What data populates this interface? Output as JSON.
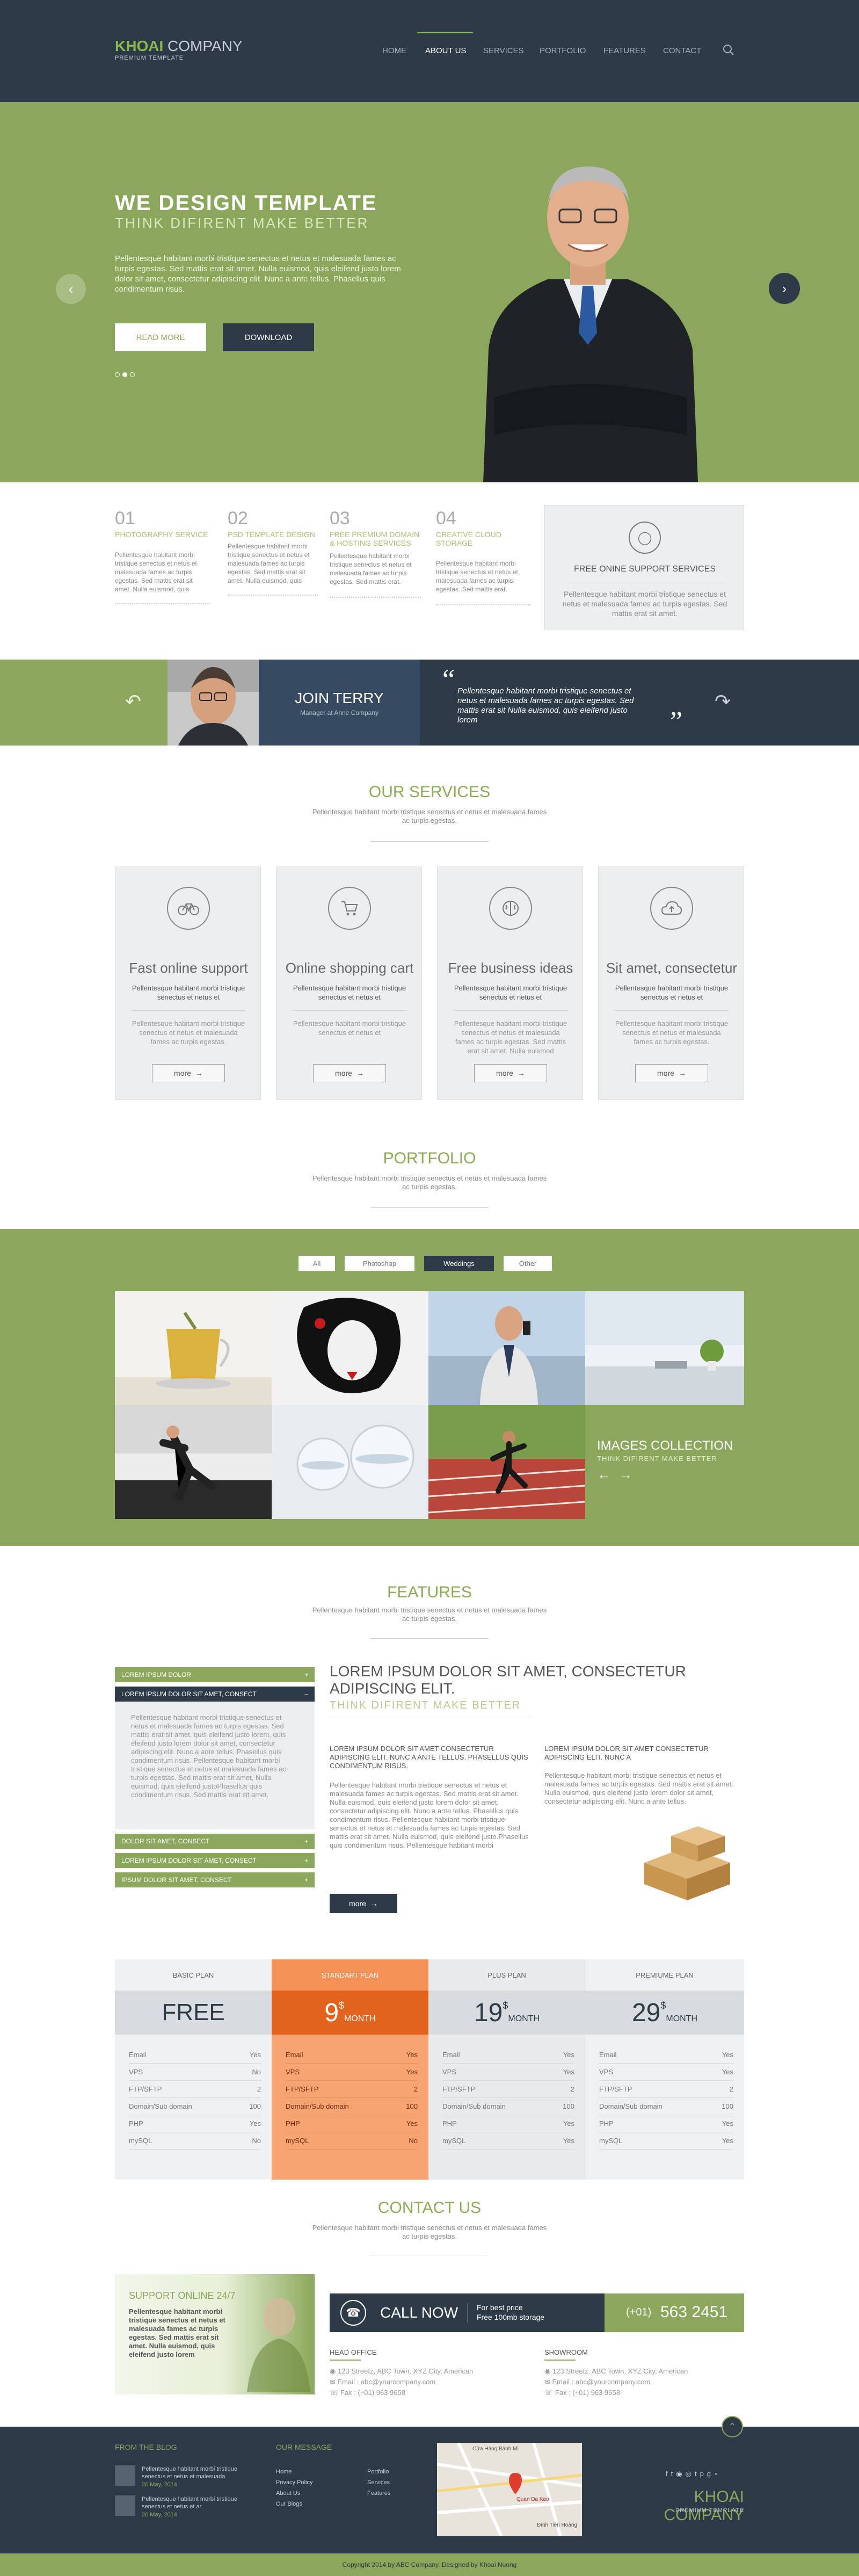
{
  "brand": {
    "name_bold": "KHOAI",
    "name_light": " COMPANY",
    "tagline": "PREMIUM TEMPLATE"
  },
  "nav": {
    "items": [
      "HOME",
      "ABOUT US",
      "SERVICES",
      "PORTFOLIO",
      "FEATURES",
      "CONTACT"
    ],
    "active": "ABOUT US"
  },
  "hero": {
    "title": "WE DESIGN TEMPLATE",
    "subtitle": "THINK DIFIRENT MAKE BETTER",
    "body": "Pellentesque habitant morbi tristique senectus et netus et malesuada fames ac turpis egestas. Sed mattis erat sit amet. Nulla euismod, quis eleifend justo lorem dolor sit amet, consectetur adipiscing elit. Nunc a ante tellus. Phasellus quis condimentum risus.",
    "read_more": "READ MORE",
    "download": "DOWNLOAD",
    "slides": 3
  },
  "features_row": [
    {
      "num": "01",
      "title": "PHOTOGRAPHY SERVICE",
      "text": "Pellentesque habitant morbi tristique senectus et netus et malesuada fames ac turpis egestas. Sed mattis erat sit amet. Nulla euismod, quis eleifend justo lorem."
    },
    {
      "num": "02",
      "title": "PSD TEMPLATE DESIGN",
      "text": "Pellentesque habitant morbi tristique senectus et netus et malesuada fames ac turpis egestas. Sed mattis erat sit amet. Nulla euismod, quis eleifend justo lorem."
    },
    {
      "num": "03",
      "title": "FREE PREMIUM DOMAIN & HOSTING SERVICES",
      "text": "Pellentesque habitant morbi tristique senectus et netus et malesuada fames ac turpis egestas. Sed mattis erat."
    },
    {
      "num": "04",
      "title": "CREATIVE CLOUD STORAGE",
      "text": "Pellentesque habitant morbi tristique senectus et netus et malesuada fames ac turpis egestas. Sed mattis erat."
    }
  ],
  "support_box": {
    "title": "FREE ONINE SUPPORT SERVICES",
    "text": "Pellentesque habitant morbi tristique senectus et netus et malesuada fames ac turpis egestas. Sed mattis erat sit amet."
  },
  "testimonial": {
    "name": "JOIN TERRY",
    "role": "Manager at Anne Company",
    "quote": "Pellentesque habitant morbi tristique senectus et netus et malesuada fames ac turpis egestas. Sed mattis erat sit Nulla euismod, quis eleifend justo lorem"
  },
  "services": {
    "heading": "OUR SERVICES",
    "sub": "Pellentesque habitant morbi tristique senectus et netus et malesuada fames ac turpis egestas.",
    "cards": [
      {
        "title": "Fast online support",
        "t1": "Pellentesque habitant morbi tristique senectus et netus et",
        "t2": "Pellentesque habitant morbi tristique senectus et netus et malesuada fames ac turpis egestas.",
        "more": "more"
      },
      {
        "title": "Online shopping cart",
        "t1": "Pellentesque habitant morbi tristique senectus et netus et",
        "t2": "Pellentesque habitant morbi tristique senectus et netus et",
        "more": "more"
      },
      {
        "title": "Free business ideas",
        "t1": "Pellentesque habitant morbi tristique senectus et netus et",
        "t2": "Pellentesque habitant morbi tristique senectus et netus et malesuada fames ac turpis egestas. Sed mattis erat sit amet. Nulla euismod",
        "more": "more"
      },
      {
        "title": "Sit amet, consectetur",
        "t1": "Pellentesque habitant morbi tristique senectus et netus et",
        "t2": "Pellentesque habitant morbi tristique senectus et netus et malesuada fames ac turpis egestas.",
        "more": "more"
      }
    ]
  },
  "portfolio": {
    "heading": "PORTFOLIO",
    "sub": "Pellentesque habitant morbi tristique senectus et netus et malesuada fames ac turpis egestas.",
    "filters": [
      "All",
      "Photoshop",
      "Weddings",
      "Other"
    ],
    "active_filter": "Weddings",
    "collection_title": "IMAGES COLLECTION",
    "collection_sub": "THINK DIFIRENT MAKE BETTER"
  },
  "features": {
    "heading": "FEATURES",
    "sub": "Pellentesque habitant morbi tristique senectus et netus et malesuada fames ac turpis egestas.",
    "accordion": [
      "LOREM IPSUM DOLOR",
      "LOREM IPSUM DOLOR SIT AMET, CONSECT",
      "DOLOR SIT AMET, CONSECT",
      "LOREM IPSUM DOLOR SIT AMET, CONSECT",
      "IPSUM DOLOR SIT AMET, CONSECT"
    ],
    "accordion_body": "Pellentesque habitant morbi tristique senectus et netus et malesuada fames ac turpis egestas. Sed mattis erat sit amet, quis eleifend justo lorem, quis eleifend justo lorem dolor sit amet, consectetur adipiscing elit. Nunc a ante tellus. Phasellus quis condimentum risus. Pellentesque habitant morbi tristique senectus et netus et malesuada fames ac turpis egestas. Sed mattis erat sit amet, Nulla euismod, quis eleifend justoPhasellus quis condimentum risus. Sed mattis erat sit amet.",
    "big_title": "LOREM IPSUM DOLOR SIT AMET, CONSECTETUR ADIPISCING ELIT.",
    "big_sub": "THINK DIFIRENT MAKE BETTER",
    "col1_head": "LOREM IPSUM DOLOR SIT AMET CONSECTETUR ADIPISCING ELIT. NUNC A ANTE TELLUS. PHASELLUS QUIS CONDIMENTUM RISUS.",
    "col1_text": "Pellentesque habitant morbi tristique senectus et netus et malesuada fames ac turpis egestas. Sed mattis erat sit amet. Nulla euismod, quis eleifend justo lorem dolor sit amet, consectetur adipiscing elit. Nunc a ante tellus. Phasellus quis condimentum risus. Pellentesque habitant morbi tristique senectus et netus et malesuada fames ac turpis egestas. Sed mattis erat sit amet. Nulla euismod, quis eleifend justo.Phasellus quis condimentum risus. Pellentesque habitant morbi",
    "col2_head": "LOREM IPSUM DOLOR SIT AMET CONSECTETUR ADIPISCING ELIT. NUNC A",
    "col2_text": "Pellentesque habitant morbi tristique senectus et netus et malesuada fames ac turpis egestas. Sed mattis erat sit amet. Nulla euismod, quis eleifend justo lorem dolor sit amet, consectetur adipiscing elit. Nunc a ante tellus.",
    "more": "more"
  },
  "pricing": {
    "plans": [
      {
        "name": "BASIC PLAN",
        "price": "FREE",
        "currency": "",
        "period": ""
      },
      {
        "name": "STANDART PLAN",
        "price": "9",
        "currency": "$",
        "period": "MONTH"
      },
      {
        "name": "PLUS PLAN",
        "price": "19",
        "currency": "$",
        "period": "MONTH"
      },
      {
        "name": "PREMIUME PLAN",
        "price": "29",
        "currency": "$",
        "period": "MONTH"
      }
    ],
    "rows": [
      {
        "label": "Email",
        "values": [
          "Yes",
          "Yes",
          "Yes",
          "Yes"
        ]
      },
      {
        "label": "VPS",
        "values": [
          "No",
          "Yes",
          "Yes",
          "Yes"
        ]
      },
      {
        "label": "FTP/SFTP",
        "values": [
          "2",
          "2",
          "2",
          "2"
        ]
      },
      {
        "label": "Domain/Sub domain",
        "values": [
          "100",
          "100",
          "100",
          "100"
        ]
      },
      {
        "label": "PHP",
        "values": [
          "Yes",
          "Yes",
          "Yes",
          "Yes"
        ]
      },
      {
        "label": "mySQL",
        "values": [
          "No",
          "No",
          "Yes",
          "Yes"
        ]
      }
    ]
  },
  "contact": {
    "heading": "CONTACT US",
    "sub": "Pellentesque habitant morbi tristique senectus et netus et malesuada fames ac turpis egestas.",
    "support_title": "SUPPORT ONLINE 24/7",
    "support_text": "Pellentesque habitant morbi tristique senectus et netus et malesuada fames ac turpis egestas. Sed mattis erat sit amet. Nulla euismod, quis eleifend justo lorem",
    "call_label": "CALL NOW",
    "call_note1": "For best price",
    "call_note2": "Free 100mb storage",
    "phone_prefix": "(+01)",
    "phone": "563 2451",
    "office_title": "HEAD OFFICE",
    "office_addr": "123 Streetz, ABC Town, XYZ City, American",
    "office_email": "Email : abc@yourcompany.com",
    "office_fax": "Fax : (+01) 963 9658",
    "showroom_title": "SHOWROOM",
    "showroom_addr": "123 Streetz, ABC Town, XYZ City, American",
    "showroom_email": "Email : abc@yourcompany.com",
    "showroom_fax": "Fax : (+01) 963 9658"
  },
  "footer": {
    "blog_title": "FROM THE BLOG",
    "blog": [
      {
        "text": "Pellentesque habitant morbi tristique senectus et netus et malesuada",
        "date": "26 May, 2014"
      },
      {
        "text": "Pellentesque habitant morbi tristique senectus et netus et ar",
        "date": "26 May, 2014"
      }
    ],
    "message_title": "OUR MESSAGE",
    "links_col1": [
      "Home",
      "Privacy Policy",
      "About Us",
      "Our Blogs"
    ],
    "links_col2": [
      "Portfolio",
      "Services",
      "Features"
    ],
    "map_place": "Quan Da Kao",
    "map_label1": "Cửa Hàng Bánh Mì",
    "map_label2": "Đình Tiên Hoàng",
    "copyright": "Copyright 2014 by ABC Company. Designed by Khoai Nuong"
  },
  "colors": {
    "accent": "#8ba75b",
    "dark": "#2d3a48",
    "orange": "#e2631e"
  }
}
